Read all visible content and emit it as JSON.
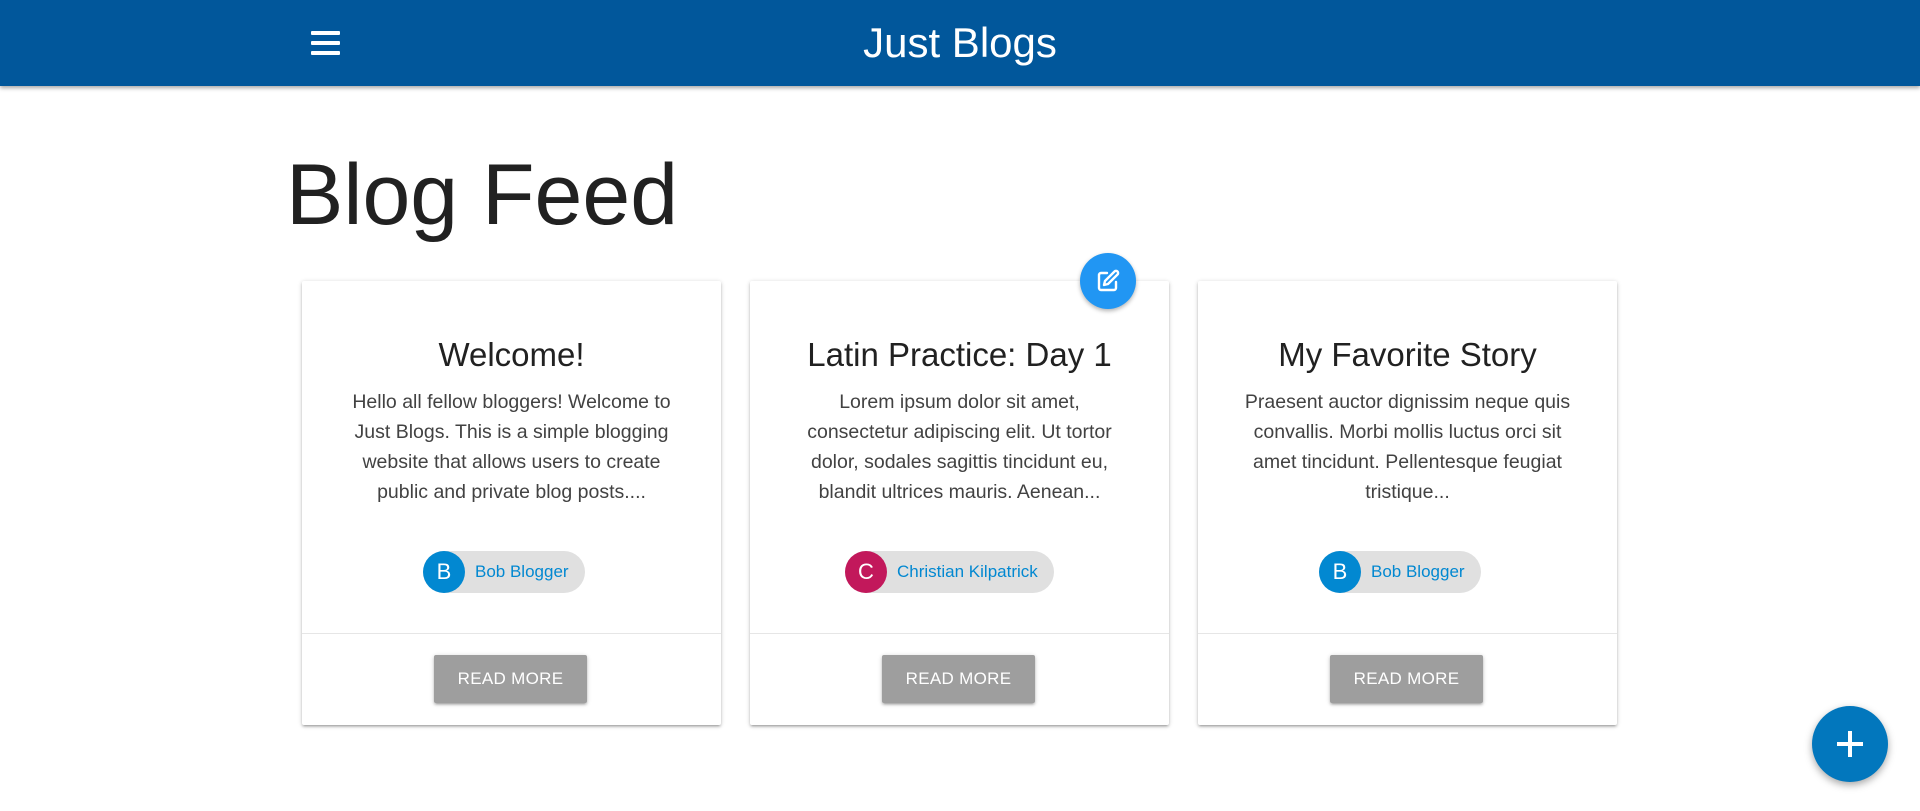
{
  "app_bar": {
    "title": "Just Blogs",
    "menu_icon": "hamburger-menu-icon",
    "background_color": "#01579b"
  },
  "page": {
    "title": "Blog Feed"
  },
  "posts": [
    {
      "title": "Welcome!",
      "excerpt": "Hello all fellow bloggers! Welcome to Just Blogs. This is a simple blogging website that allows users to create public and private blog posts....",
      "author": {
        "initial": "B",
        "name": "Bob Blogger",
        "avatar_color": "#0288d1"
      },
      "button_label": "READ MORE"
    },
    {
      "title": "Latin Practice: Day 1",
      "excerpt": "Lorem ipsum dolor sit amet, consectetur adipiscing elit. Ut tortor dolor, sodales sagittis tincidunt eu, blandit ultrices mauris. Aenean...",
      "author": {
        "initial": "C",
        "name": "Christian Kilpatrick",
        "avatar_color": "#c2185b"
      },
      "button_label": "READ MORE"
    },
    {
      "title": "My Favorite Story",
      "excerpt": "Praesent auctor dignissim neque quis convallis. Morbi mollis luctus orci sit amet tincidunt. Pellentesque feugiat tristique...",
      "author": {
        "initial": "B",
        "name": "Bob Blogger",
        "avatar_color": "#0288d1"
      },
      "button_label": "READ MORE"
    }
  ],
  "edit_fab": {
    "icon": "edit-icon",
    "color": "#2196f3"
  },
  "add_fab": {
    "icon": "plus-icon",
    "color": "#0277bd"
  }
}
